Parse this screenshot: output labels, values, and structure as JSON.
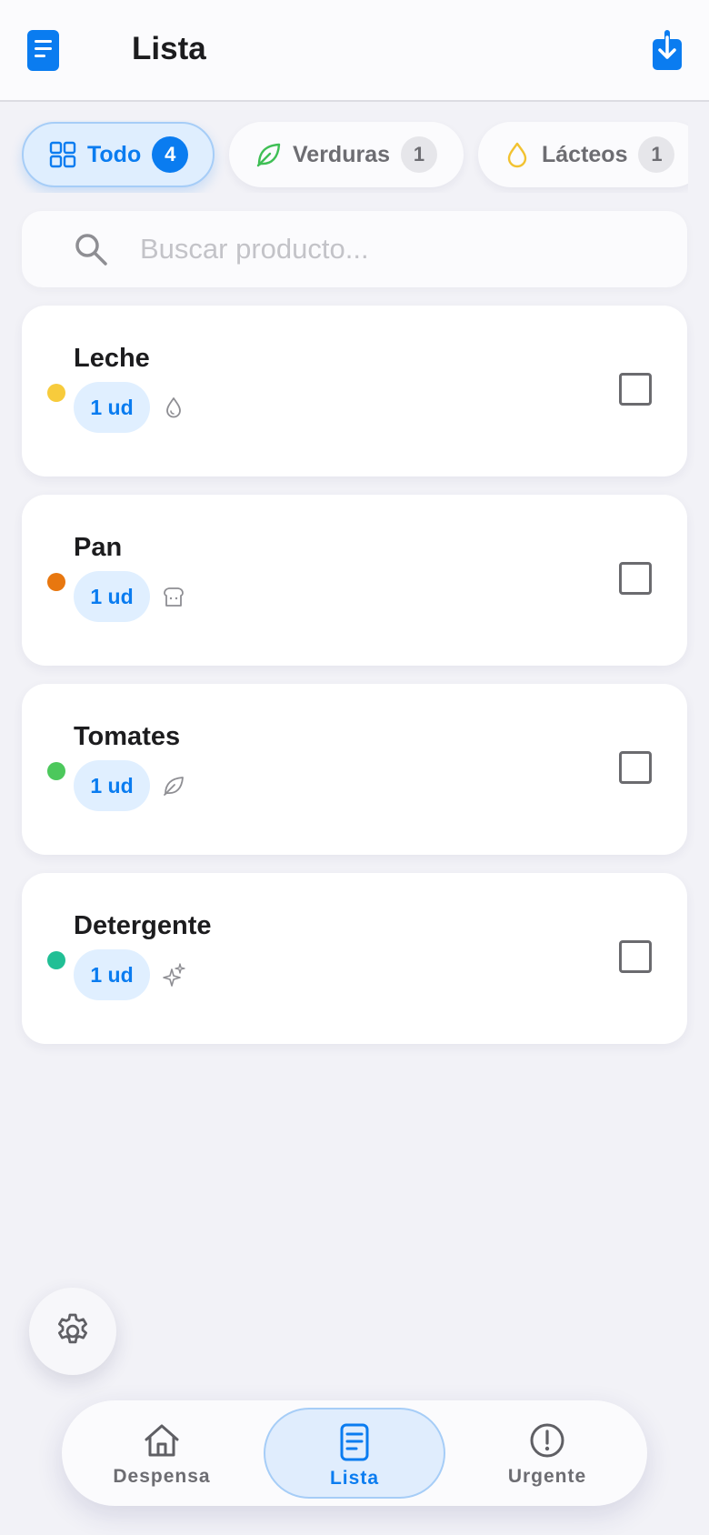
{
  "header": {
    "title": "Lista",
    "logo_icon": "list-document-icon",
    "action_icon": "download-icon"
  },
  "filters": [
    {
      "label": "Todo",
      "count": "4",
      "icon": "grid-icon",
      "active": true
    },
    {
      "label": "Verduras",
      "count": "1",
      "icon": "leaf-icon",
      "active": false
    },
    {
      "label": "Lácteos",
      "count": "1",
      "icon": "drop-icon",
      "active": false
    }
  ],
  "search": {
    "placeholder": "Buscar producto...",
    "value": ""
  },
  "items": [
    {
      "name": "Leche",
      "quantity": "1 ud",
      "dot_color": "#f7cb3c",
      "icon": "drop-icon",
      "checked": false
    },
    {
      "name": "Pan",
      "quantity": "1 ud",
      "dot_color": "#e8770f",
      "icon": "bread-icon",
      "checked": false
    },
    {
      "name": "Tomates",
      "quantity": "1 ud",
      "dot_color": "#4cc85c",
      "icon": "leaf-icon",
      "checked": false
    },
    {
      "name": "Detergente",
      "quantity": "1 ud",
      "dot_color": "#21bf95",
      "icon": "sparkles-icon",
      "checked": false
    }
  ],
  "settings_icon": "gear-icon",
  "tabbar": [
    {
      "label": "Despensa",
      "icon": "house-icon",
      "active": false
    },
    {
      "label": "Lista",
      "icon": "list-document-icon",
      "active": true
    },
    {
      "label": "Urgente",
      "icon": "alert-circle-icon",
      "active": false
    }
  ],
  "colors": {
    "accent": "#0a7cf0",
    "background": "#f2f2f7",
    "card": "#ffffff"
  }
}
